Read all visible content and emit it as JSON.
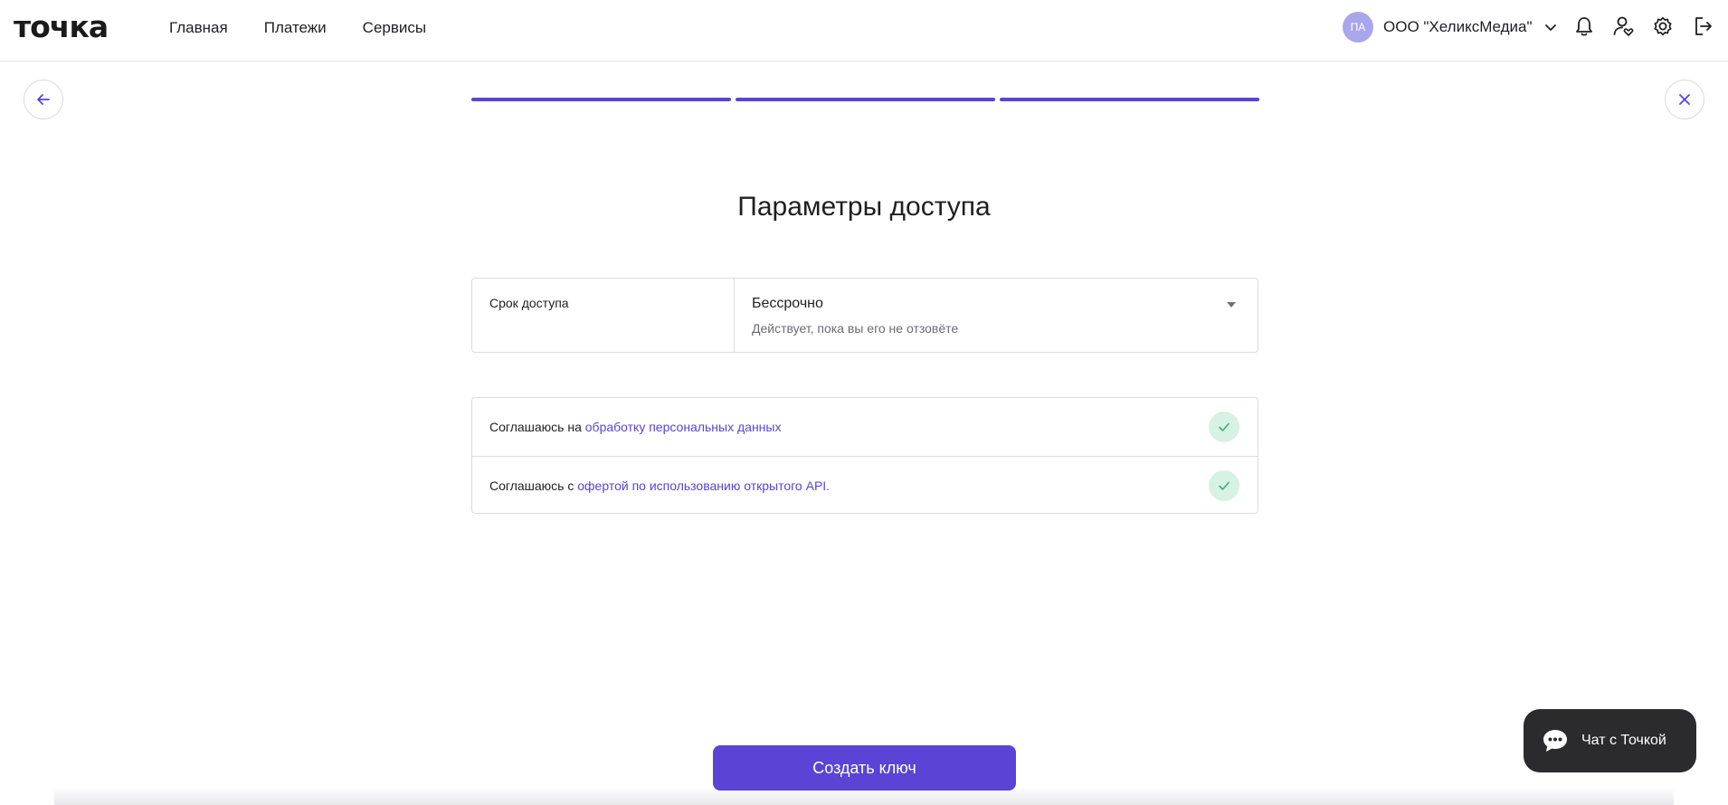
{
  "header": {
    "logo": "точка",
    "nav": [
      {
        "label": "Главная"
      },
      {
        "label": "Платежи"
      },
      {
        "label": "Сервисы"
      }
    ],
    "org": {
      "initials": "ПА",
      "name": "ООО \"ХеликсМедиа\""
    },
    "icons": [
      "bell-icon",
      "user-heart-icon",
      "gear-icon",
      "logout-icon"
    ]
  },
  "steps": {
    "total": 3,
    "completed": 3
  },
  "page": {
    "title": "Параметры доступа"
  },
  "access": {
    "label": "Срок доступа",
    "value": "Бессрочно",
    "hint": "Действует, пока вы его не отзовёте"
  },
  "consents": [
    {
      "prefix": "Соглашаюсь на ",
      "link": "обработку персональных данных",
      "checked": true
    },
    {
      "prefix": "Соглашаюсь с ",
      "link": "офертой по использованию открытого API.",
      "checked": true
    }
  ],
  "actions": {
    "create_label": "Создать ключ"
  },
  "chat": {
    "label": "Чат с Точкой"
  },
  "colors": {
    "accent": "#5b43d6",
    "check_bg": "#d7f1e4",
    "check_mark": "#3cb07a",
    "chat_bg": "#2b2b2d"
  }
}
